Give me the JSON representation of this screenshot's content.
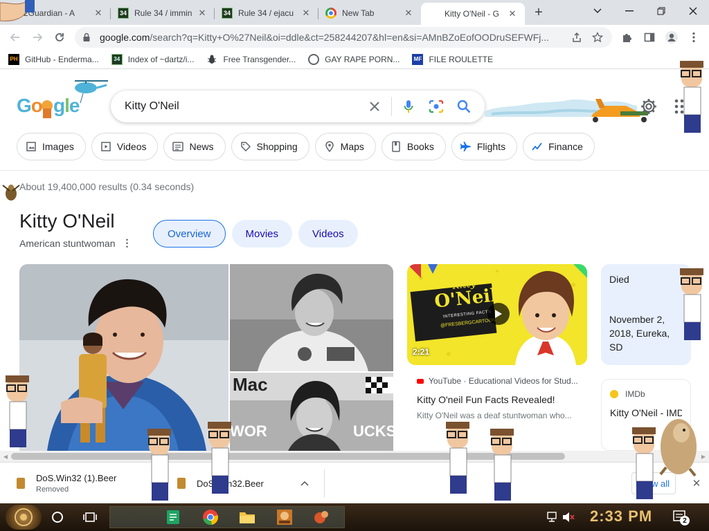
{
  "tabs": [
    {
      "title": "2Guardian - A",
      "icon": "user-icon"
    },
    {
      "title": "Rule 34 / immin",
      "icon": "r34-icon"
    },
    {
      "title": "Rule 34 / ejacu",
      "icon": "r34-icon"
    },
    {
      "title": "New Tab",
      "icon": "chrome-icon"
    },
    {
      "title": "Kitty O'Neil - G",
      "icon": "google-icon",
      "active": true
    }
  ],
  "toolbar": {
    "url_host": "google.com",
    "url_path": "/search?q=Kitty+O%27Neil&oi=ddle&ct=258244207&hl=en&si=AMnBZoEofOODruSEFWFj..."
  },
  "bookmarks": [
    {
      "label": "GitHub - Enderma...",
      "icon_text": "PH"
    },
    {
      "label": "Index of ~dartz/i...",
      "icon_text": "34"
    },
    {
      "label": "Free Transgender...",
      "icon_text": ""
    },
    {
      "label": "GAY RAPE PORN...",
      "icon_text": ""
    },
    {
      "label": "FILE ROULETTE",
      "icon_text": "MF"
    }
  ],
  "google": {
    "doodle_text": "Google",
    "query": "Kitty O'Neil",
    "chips": [
      "Images",
      "Videos",
      "News",
      "Shopping",
      "Maps",
      "Books",
      "Flights",
      "Finance"
    ]
  },
  "results": {
    "stats": "About 19,400,000 results (0.34 seconds)",
    "kp_title": "Kitty O'Neil",
    "kp_subtitle": "American stuntwoman",
    "kp_tabs": [
      "Overview",
      "Movies",
      "Videos"
    ],
    "video": {
      "thumb_title_1": "Kitty",
      "thumb_title_2": "O'Neil",
      "thumb_caption": "INTERESTING FACTS",
      "thumb_handle": "@FRESBERGCARTOON",
      "duration": "2:21",
      "source": "YouTube · Educational Videos for Stud...",
      "title": "Kitty O'neil Fun Facts Revealed!",
      "desc": "Kitty O'Neil was a deaf stuntwoman who..."
    },
    "died": {
      "label": "Died",
      "value": "November 2, 2018, Eureka, SD"
    },
    "imdb": {
      "source": "IMDb",
      "title": "Kitty O'Neil - IMDb"
    }
  },
  "downloads": [
    {
      "name": "DoS.Win32 (1).Beer",
      "status": "Removed"
    },
    {
      "name": "DoS.Win32.Beer",
      "status": ""
    }
  ],
  "downloads_show_all": "Show all",
  "taskbar": {
    "time": "2:33 PM",
    "notifications": "2"
  }
}
